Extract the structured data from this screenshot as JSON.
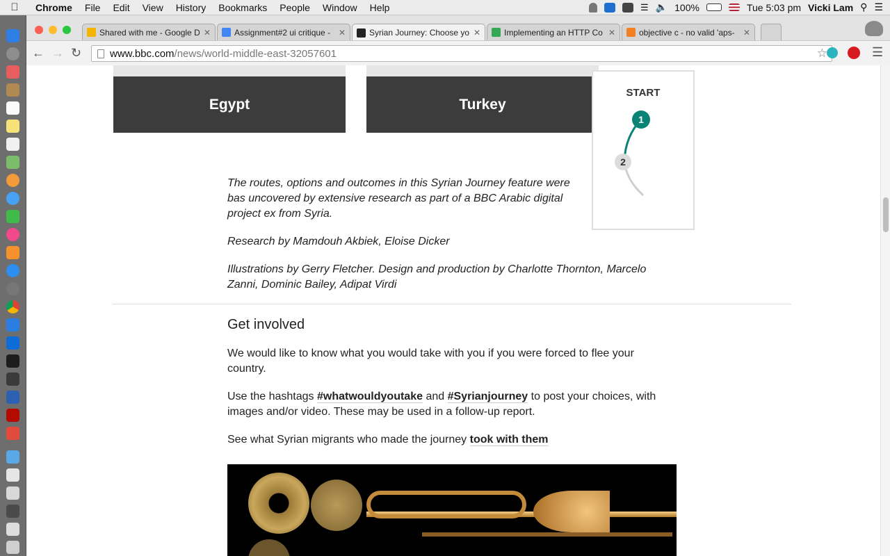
{
  "menubar": {
    "app": "Chrome",
    "items": [
      "File",
      "Edit",
      "View",
      "History",
      "Bookmarks",
      "People",
      "Window",
      "Help"
    ],
    "battery": "100%",
    "clock": "Tue 5:03 pm",
    "user": "Vicki Lam"
  },
  "tabs": [
    {
      "title": "Shared with me - Google D",
      "color": "#f4b400"
    },
    {
      "title": "Assignment#2 ui critique -",
      "color": "#4285f4"
    },
    {
      "title": "Syrian Journey: Choose yo",
      "color": "#222222"
    },
    {
      "title": "Implementing an HTTP Co",
      "color": "#34a853"
    },
    {
      "title": "objective c - no valid 'aps-",
      "color": "#f48024"
    }
  ],
  "address": {
    "host": "www.bbc.com",
    "path": "/news/world-middle-east-32057601"
  },
  "page": {
    "country_left": "Egypt",
    "country_right": "Turkey",
    "journey": {
      "title": "START",
      "step1": "1",
      "step2": "2"
    },
    "credits_routes": "The routes, options and outcomes in this Syrian Journey feature were bas uncovered by extensive research as part of a BBC Arabic digital project ex from Syria.",
    "credits_research": "Research by Mamdouh Akbiek, Eloise Dicker",
    "credits_illustrations": "Illustrations by Gerry Fletcher. Design and production by Charlotte Thornton, Marcelo Zanni, Dominic Bailey, Adipat Virdi",
    "get_involved_heading": "Get involved",
    "get_involved_p1": "We would like to know what you would take with you if you were forced to flee your country.",
    "hashtags": {
      "prefix": "Use the hashtags ",
      "tag1": "#whatwouldyoutake",
      "mid": " and ",
      "tag2": "#Syrianjourney",
      "suffix": " to post your choices, with images and/or video. These may be used in a follow-up report."
    },
    "see_what": {
      "prefix": "See what Syrian migrants who made the journey ",
      "link": "took with them"
    }
  }
}
